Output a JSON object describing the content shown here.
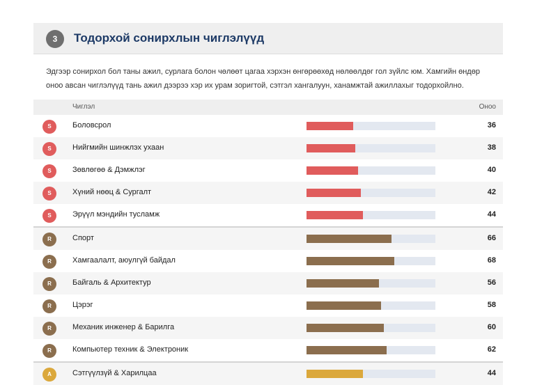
{
  "section": {
    "number": "3",
    "title": "Тодорхой сонирхлын чиглэлүүд",
    "description": "Эдгээр сонирхол бол таны ажил, сурлага болон чөлөөт цагаа хэрхэн өнгөрөөхөд нөлөөлдөг гол зүйлс юм. Хамгийн өндөр оноо авсан чиглэлүүд тань ажил дээрээ хэр их урам зоригтой, сэтгэл хангалуун, ханамжтай ажиллахыг тодорхойлно."
  },
  "table": {
    "col_name": "Чиглэл",
    "col_score": "Оноо",
    "max_score": 100
  },
  "colors": {
    "S": "#e05c5c",
    "R": "#8b6e4e",
    "A": "#dba83c"
  },
  "rows": [
    {
      "code": "S",
      "name": "Боловсрол",
      "score": 36
    },
    {
      "code": "S",
      "name": "Нийгмийн шинжлэх ухаан",
      "score": 38
    },
    {
      "code": "S",
      "name": "Зөвлөгөө & Дэмжлэг",
      "score": 40
    },
    {
      "code": "S",
      "name": "Хүний нөөц & Сургалт",
      "score": 42
    },
    {
      "code": "S",
      "name": "Эрүүл мэндийн тусламж",
      "score": 44
    },
    {
      "code": "R",
      "name": "Спорт",
      "score": 66
    },
    {
      "code": "R",
      "name": "Хамгаалалт, аюулгүй байдал",
      "score": 68
    },
    {
      "code": "R",
      "name": "Байгаль & Архитектур",
      "score": 56
    },
    {
      "code": "R",
      "name": "Цэрэг",
      "score": 58
    },
    {
      "code": "R",
      "name": "Механик инженер & Барилга",
      "score": 60
    },
    {
      "code": "R",
      "name": "Компьютер техник & Электроник",
      "score": 62
    },
    {
      "code": "A",
      "name": "Сэтгүүлзүй & Харилцаа",
      "score": 44
    }
  ]
}
